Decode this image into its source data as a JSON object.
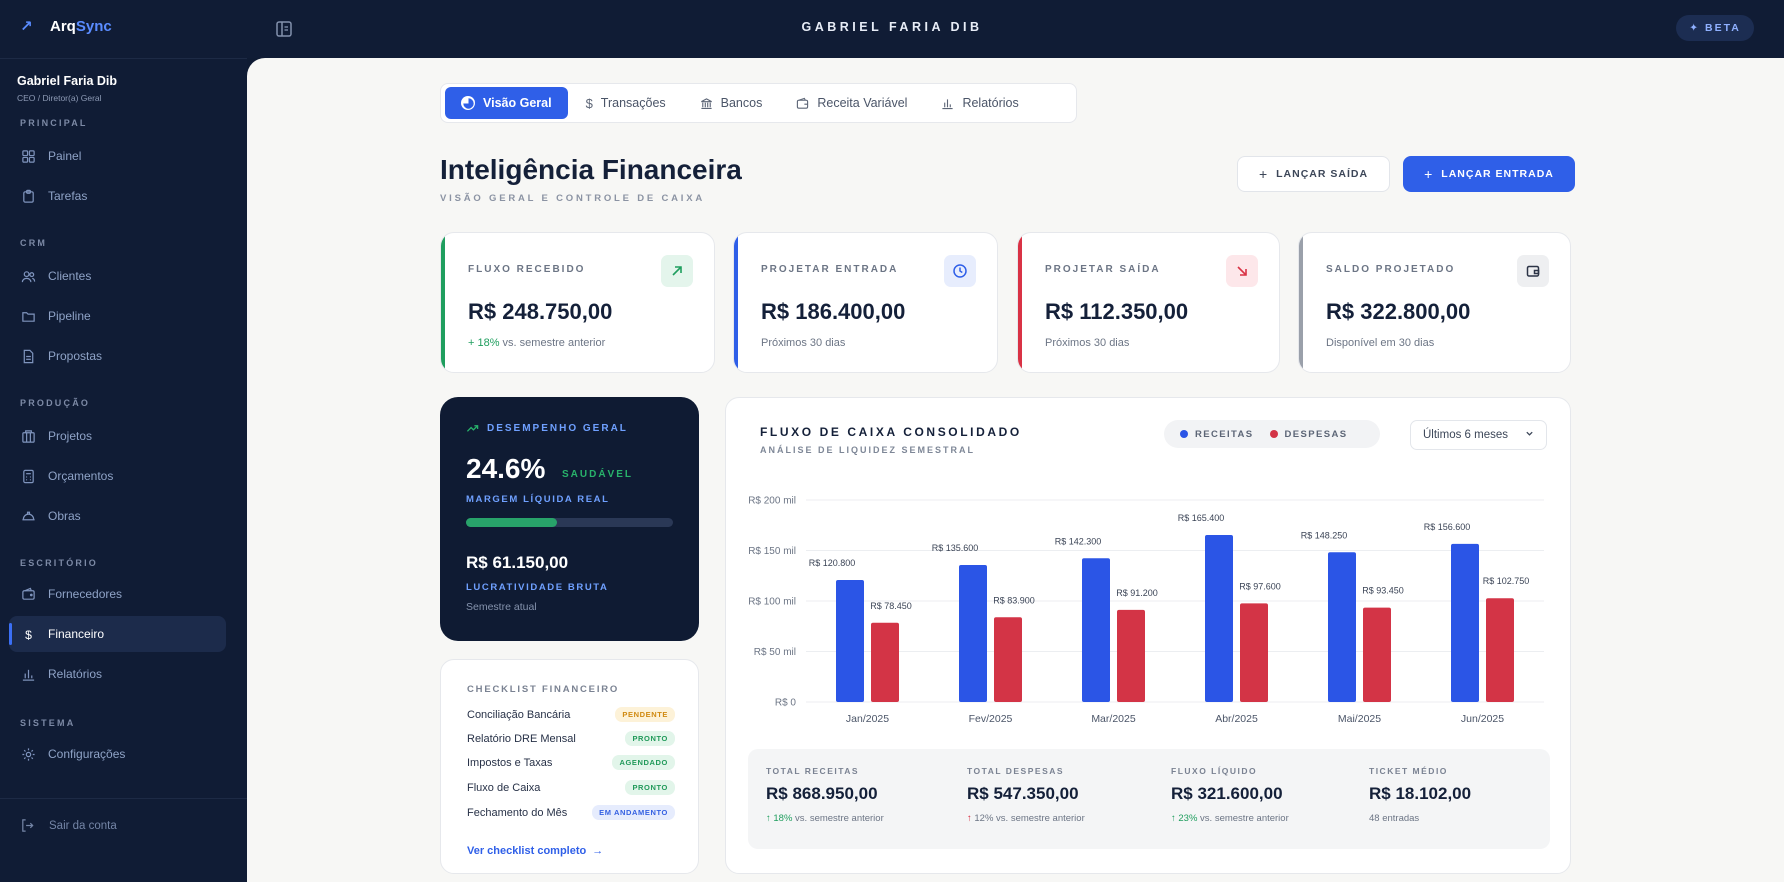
{
  "app": {
    "brand_prefix": "Arq",
    "brand_suffix": "Sync",
    "top_user": "GABRIEL FARIA DIB",
    "beta": "BETA"
  },
  "user": {
    "name": "Gabriel Faria Dib",
    "role": "CEO / Diretor(a) Geral"
  },
  "sidebar": {
    "sections": [
      "PRINCIPAL",
      "CRM",
      "PRODUÇÃO",
      "ESCRITÓRIO",
      "SISTEMA"
    ],
    "items": [
      {
        "label": "Painel",
        "icon": "grid-icon"
      },
      {
        "label": "Tarefas",
        "icon": "clipboard-icon"
      },
      {
        "label": "Clientes",
        "icon": "users-icon"
      },
      {
        "label": "Pipeline",
        "icon": "folder-icon"
      },
      {
        "label": "Propostas",
        "icon": "document-icon"
      },
      {
        "label": "Projetos",
        "icon": "building-icon"
      },
      {
        "label": "Orçamentos",
        "icon": "calculator-icon"
      },
      {
        "label": "Obras",
        "icon": "helmet-icon"
      },
      {
        "label": "Fornecedores",
        "icon": "wallet-icon"
      },
      {
        "label": "Financeiro",
        "icon": "dollar-icon",
        "active": true
      },
      {
        "label": "Relatórios",
        "icon": "bar-chart-icon"
      },
      {
        "label": "Configurações",
        "icon": "gear-icon"
      }
    ],
    "logout": "Sair da conta"
  },
  "tabs": [
    {
      "label": "Visão Geral",
      "active": true
    },
    {
      "label": "Transações"
    },
    {
      "label": "Bancos"
    },
    {
      "label": "Receita Variável"
    },
    {
      "label": "Relatórios"
    }
  ],
  "header": {
    "title": "Inteligência Financeira",
    "subtitle": "VISÃO GERAL E CONTROLE DE CAIXA",
    "btn_out": "LANÇAR SAÍDA",
    "btn_in": "LANÇAR ENTRADA"
  },
  "kpis": [
    {
      "label": "FLUXO RECEBIDO",
      "value": "R$ 248.750,00",
      "sub_pos": "+ 18%",
      "sub": " vs. semestre anterior",
      "color": "#1f9e5e"
    },
    {
      "label": "PROJETAR ENTRADA",
      "value": "R$ 186.400,00",
      "sub_pos": "",
      "sub": "Próximos 30 dias",
      "color": "#2f5fe8"
    },
    {
      "label": "PROJETAR SAÍDA",
      "value": "R$ 112.350,00",
      "sub_pos": "",
      "sub": "Próximos 30 dias",
      "color": "#d93245"
    },
    {
      "label": "SALDO PROJETADO",
      "value": "R$ 322.800,00",
      "sub_pos": "",
      "sub": "Disponível em 30 dias",
      "color": "#9aa0aa"
    }
  ],
  "performance": {
    "label": "DESEMPENHO GERAL",
    "pct": "24.6%",
    "health": "SAUDÁVEL",
    "margin_label": "MARGEM LÍQUIDA REAL",
    "margin_fraction": 0.44,
    "gross": "R$ 61.150,00",
    "gross_label": "LUCRATIVIDADE BRUTA",
    "period": "Semestre atual"
  },
  "checklist": {
    "title": "CHECKLIST FINANCEIRO",
    "items": [
      {
        "label": "Conciliação Bancária",
        "status": "PENDENTE"
      },
      {
        "label": "Relatório DRE Mensal",
        "status": "PRONTO"
      },
      {
        "label": "Impostos e Taxas",
        "status": "AGENDADO"
      },
      {
        "label": "Fluxo de Caixa",
        "status": "PRONTO"
      },
      {
        "label": "Fechamento do Mês",
        "status": "EM ANDAMENTO"
      }
    ],
    "link": "Ver checklist completo"
  },
  "cashflow": {
    "title": "FLUXO DE CAIXA CONSOLIDADO",
    "subtitle": "ANÁLISE DE LIQUIDEZ SEMESTRAL",
    "range": "Últimos 6 meses"
  },
  "chart_data": {
    "type": "bar",
    "categories": [
      "Jan/2025",
      "Fev/2025",
      "Mar/2025",
      "Abr/2025",
      "Mai/2025",
      "Jun/2025"
    ],
    "series": [
      {
        "name": "RECEITAS",
        "color": "#2b55e6",
        "values": [
          120800,
          135600,
          142300,
          165400,
          148250,
          156600
        ],
        "labels": [
          "R$ 120.800",
          "R$ 135.600",
          "R$ 142.300",
          "R$ 165.400",
          "R$ 148.250",
          "R$ 156.600"
        ]
      },
      {
        "name": "DESPESAS",
        "color": "#d33446",
        "values": [
          78450,
          83900,
          91200,
          97600,
          93450,
          102750
        ],
        "labels": [
          "R$ 78.450",
          "R$ 83.900",
          "R$ 91.200",
          "R$ 97.600",
          "R$ 93.450",
          "R$ 102.750"
        ]
      }
    ],
    "y_ticks": [
      "R$ 0",
      "R$ 50 mil",
      "R$ 100 mil",
      "R$ 150 mil",
      "R$ 200 mil"
    ],
    "ylim": [
      0,
      200000
    ],
    "grid": true
  },
  "totals": [
    {
      "label": "TOTAL RECEITAS",
      "value": "R$ 868.950,00",
      "trend": "18%",
      "trend_sub": " vs. semestre anterior",
      "dir": "up"
    },
    {
      "label": "TOTAL DESPESAS",
      "value": "R$ 547.350,00",
      "trend": "12%",
      "trend_sub": " vs. semestre anterior",
      "dir": "up-red"
    },
    {
      "label": "FLUXO LÍQUIDO",
      "value": "R$ 321.600,00",
      "trend": "23%",
      "trend_sub": " vs. semestre anterior",
      "dir": "up"
    },
    {
      "label": "TICKET MÉDIO",
      "value": "R$ 18.102,00",
      "trend": "",
      "trend_sub": "48 entradas",
      "dir": "none"
    }
  ]
}
